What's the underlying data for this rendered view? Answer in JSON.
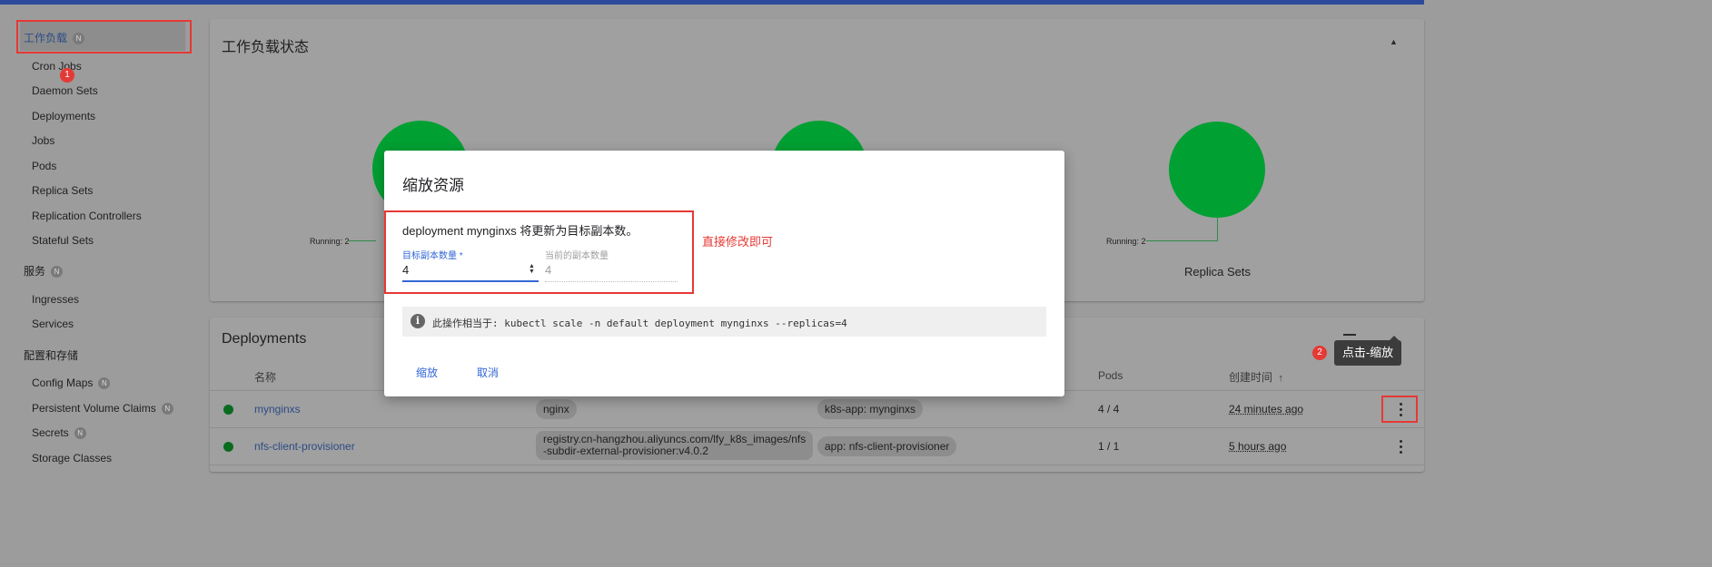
{
  "sidebar": {
    "workloads": {
      "label": "工作负载",
      "badge": "N"
    },
    "workload_items": [
      "Cron Jobs",
      "Daemon Sets",
      "Deployments",
      "Jobs",
      "Pods",
      "Replica Sets",
      "Replication Controllers",
      "Stateful Sets"
    ],
    "service": {
      "label": "服务",
      "badge": "N"
    },
    "service_items": [
      "Ingresses",
      "Services"
    ],
    "config": {
      "label": "配置和存储"
    },
    "config_items": [
      {
        "label": "Config Maps",
        "badge": "N"
      },
      {
        "label": "Persistent Volume Claims",
        "badge": "N"
      },
      {
        "label": "Secrets",
        "badge": "N"
      },
      {
        "label": "Storage Classes",
        "badge": ""
      }
    ]
  },
  "workload_status": {
    "title": "工作负载状态",
    "charts": [
      {
        "running_label": "Running: 2",
        "caption": ""
      },
      {
        "running_label": "",
        "caption": ""
      },
      {
        "running_label": "Running: 2",
        "caption": "Replica Sets"
      }
    ]
  },
  "deployments": {
    "title": "Deployments",
    "columns": {
      "name": "名称",
      "pods": "Pods",
      "created": "创建时间"
    },
    "rows": [
      {
        "name": "mynginxs",
        "image": "nginx",
        "label": "k8s-app: mynginxs",
        "pods": "4 / 4",
        "created": "24 minutes ago"
      },
      {
        "name": "nfs-client-provisioner",
        "image_line1": "registry.cn-hangzhou.aliyuncs.com/lfy_k8s_images/nfs",
        "image_line2": "-subdir-external-provisioner:v4.0.2",
        "label": "app: nfs-client-provisioner",
        "pods": "1 / 1",
        "created": "5 hours ago"
      }
    ]
  },
  "dialog": {
    "title": "缩放资源",
    "message": "deployment mynginxs 将更新为目标副本数。",
    "target_label": "目标副本数量 *",
    "target_value": "4",
    "current_label": "当前的副本数量",
    "current_value": "4",
    "info": "此操作相当于: kubectl scale -n default deployment mynginxs --replicas=4",
    "scale_button": "缩放",
    "cancel_button": "取消"
  },
  "annotations": {
    "marker1": "1",
    "marker2": "2",
    "direct_edit": "直接修改即可",
    "tooltip": "点击-缩放"
  },
  "colors": {
    "accent": "#3367d6",
    "annotation": "#e53935",
    "running": "#00a033"
  }
}
